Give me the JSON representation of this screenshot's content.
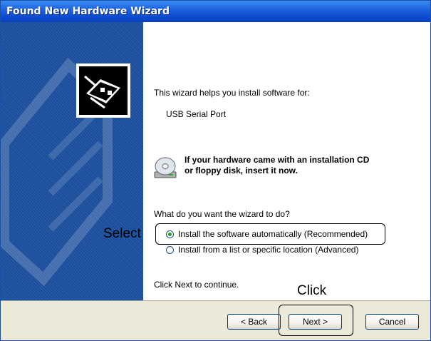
{
  "window": {
    "title": "Found New Hardware Wizard"
  },
  "content": {
    "intro": "This wizard helps you install software for:",
    "device": "USB Serial Port",
    "cd_line1": "If your hardware came with an installation CD",
    "cd_line2": "or floppy disk, insert it now.",
    "question": "What do you want the wizard to do?",
    "options": [
      {
        "label": "Install the software automatically (Recommended)",
        "selected": true
      },
      {
        "label": "Install from a list or specific location (Advanced)",
        "selected": false
      }
    ],
    "continue_text": "Click Next to continue."
  },
  "callouts": {
    "select": "Select",
    "click": "Click"
  },
  "buttons": {
    "back": "< Back",
    "next": "Next >",
    "cancel": "Cancel"
  },
  "colors": {
    "titlebar": "#0a48cc",
    "banner": "#1a4d9c",
    "footer": "#ece9d8"
  }
}
